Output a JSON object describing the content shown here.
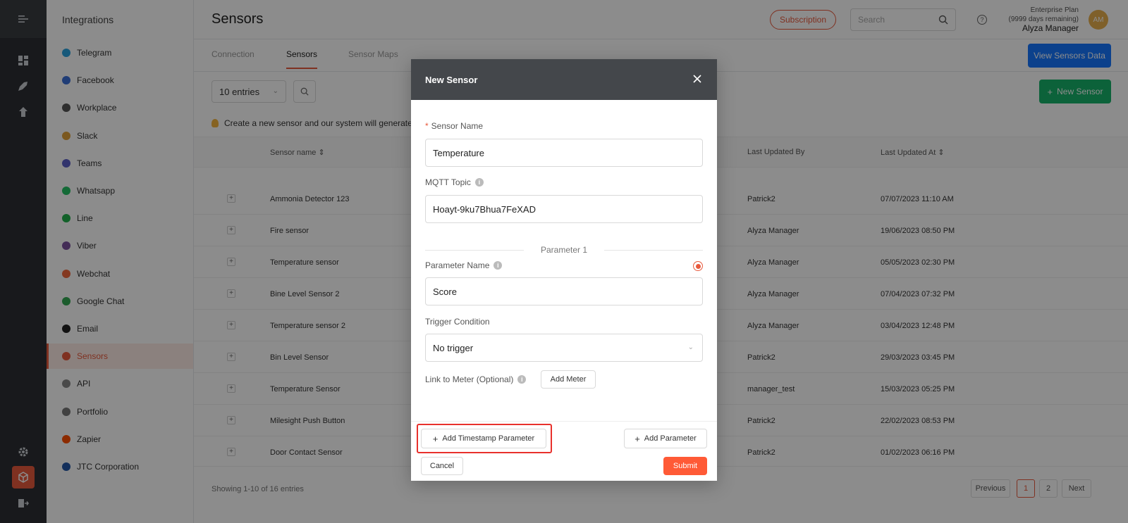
{
  "sidebar": {
    "title": "Integrations",
    "items": [
      {
        "label": "Telegram",
        "color": "#2aa3de"
      },
      {
        "label": "Facebook",
        "color": "#3b6fd8"
      },
      {
        "label": "Workplace",
        "color": "#555555"
      },
      {
        "label": "Slack",
        "color": "#e0a13a"
      },
      {
        "label": "Teams",
        "color": "#5b5fc7"
      },
      {
        "label": "Whatsapp",
        "color": "#25c265"
      },
      {
        "label": "Line",
        "color": "#22b14c"
      },
      {
        "label": "Viber",
        "color": "#7b519d"
      },
      {
        "label": "Webchat",
        "color": "#f0683c"
      },
      {
        "label": "Google Chat",
        "color": "#34a853"
      },
      {
        "label": "Email",
        "color": "#222222"
      },
      {
        "label": "Sensors",
        "color": "#e8593c"
      },
      {
        "label": "API",
        "color": "#888888"
      },
      {
        "label": "Portfolio",
        "color": "#777777"
      },
      {
        "label": "Zapier",
        "color": "#ff4f00"
      },
      {
        "label": "JTC Corporation",
        "color": "#2457a6"
      }
    ]
  },
  "header": {
    "title": "Sensors",
    "subscription": "Subscription",
    "search_placeholder": "Search",
    "help": "?",
    "plan": "Enterprise Plan",
    "remaining": "(9999 days remaining)",
    "user": "Alyza Manager",
    "avatar": "AM"
  },
  "tabs": [
    "Connection",
    "Sensors",
    "Sensor Maps"
  ],
  "view_button": "View Sensors Data",
  "toolbar": {
    "entries": "10 entries",
    "new_sensor": "New Sensor"
  },
  "info_text": "Create a new sensor and our system will generate a",
  "table": {
    "headers": [
      "Sensor name",
      "Last Updated By",
      "Last Updated At"
    ],
    "rows": [
      [
        "Ammonia Detector 123",
        "Patrick2",
        "07/07/2023 11:10 AM"
      ],
      [
        "Fire sensor",
        "Alyza Manager",
        "19/06/2023 08:50 PM"
      ],
      [
        "Temperature sensor",
        "Alyza Manager",
        "05/05/2023 02:30 PM"
      ],
      [
        "Bine Level Sensor 2",
        "Alyza Manager",
        "07/04/2023 07:32 PM"
      ],
      [
        "Temperature sensor 2",
        "Alyza Manager",
        "03/04/2023 12:48 PM"
      ],
      [
        "Bin Level Sensor",
        "Patrick2",
        "29/03/2023 03:45 PM"
      ],
      [
        "Temperature Sensor",
        "manager_test",
        "15/03/2023 05:25 PM"
      ],
      [
        "Milesight Push Button",
        "Patrick2",
        "22/02/2023 08:53 PM"
      ],
      [
        "Door Contact Sensor",
        "Patrick2",
        "01/02/2023 06:16 PM"
      ]
    ]
  },
  "footer": {
    "showing": "Showing 1-10 of 16 entries",
    "previous": "Previous",
    "page1": "1",
    "page2": "2",
    "next": "Next"
  },
  "modal": {
    "title": "New Sensor",
    "sensor_name_label": "Sensor Name",
    "sensor_name_value": "Temperature",
    "mqtt_label": "MQTT Topic",
    "mqtt_value": "Hoayt-9ku7Bhua7FeXAD",
    "parameter_heading": "Parameter 1",
    "param_name_label": "Parameter Name",
    "param_name_value": "Score",
    "trigger_label": "Trigger Condition",
    "trigger_value": "No trigger",
    "meter_label": "Link to Meter (Optional)",
    "add_meter": "Add Meter",
    "add_timestamp": "Add Timestamp Parameter",
    "add_parameter": "Add Parameter",
    "cancel": "Cancel",
    "submit": "Submit"
  }
}
